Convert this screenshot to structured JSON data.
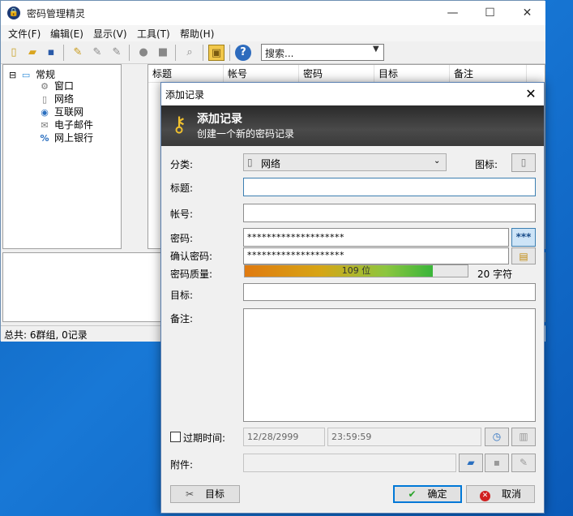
{
  "app": {
    "title": "密码管理精灵"
  },
  "window_controls": {
    "minimize": "—",
    "maximize": "☐",
    "close": "✕"
  },
  "menu": [
    "文件(F)",
    "编辑(E)",
    "显示(V)",
    "工具(T)",
    "帮助(H)"
  ],
  "search": {
    "value": "搜索..."
  },
  "tree": {
    "root": "常规",
    "expander": "⊟",
    "children": [
      "窗口",
      "网络",
      "互联网",
      "电子邮件",
      "网上银行"
    ]
  },
  "list": {
    "columns": [
      "标题",
      "帐号",
      "密码",
      "目标",
      "备注"
    ]
  },
  "status": {
    "text": "总共: 6群组, 0记录"
  },
  "dialog": {
    "title": "添加记录",
    "header_title": "添加记录",
    "header_subtitle": "创建一个新的密码记录",
    "category_label": "分类:",
    "category_value": "网络",
    "icon_label": "图标:",
    "title_label": "标题:",
    "title_value": "",
    "account_label": "帐号:",
    "account_value": "",
    "password_label": "密码:",
    "password_value": "********************",
    "password_toggle": "***",
    "confirm_label": "确认密码:",
    "confirm_value": "********************",
    "quality_label": "密码质量:",
    "quality_bits": "109 位",
    "quality_fraction": 0.845,
    "char_count": "20 字符",
    "target_label": "目标:",
    "target_value": "",
    "notes_label": "备注:",
    "notes_value": "",
    "expiry_label": "过期时间:",
    "expiry_date": "12/28/2999",
    "expiry_time": "23:59:59",
    "attachment_label": "附件:",
    "target_button": "目标",
    "ok_button": "确定",
    "cancel_button": "取消"
  }
}
